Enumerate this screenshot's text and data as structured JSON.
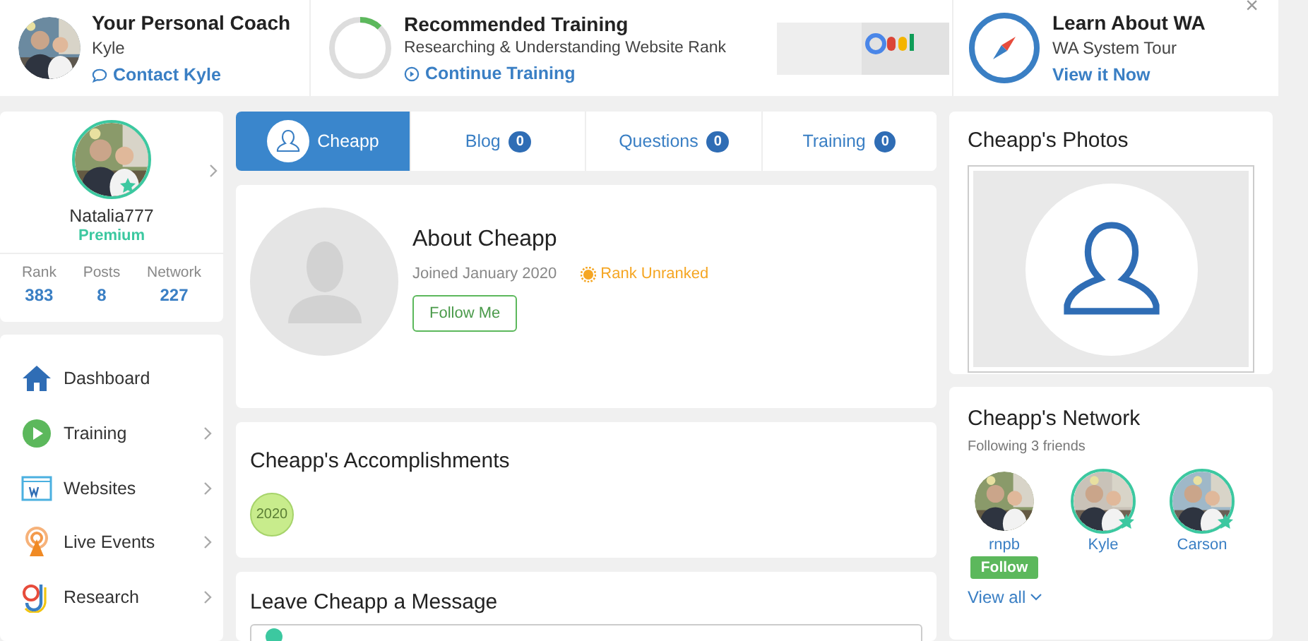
{
  "top_bar": {
    "coach": {
      "title": "Your Personal Coach",
      "name": "Kyle",
      "link": "Contact Kyle"
    },
    "training": {
      "title": "Recommended Training",
      "lesson": "Researching & Understanding Website Rank",
      "link": "Continue Training",
      "level": 0.12
    },
    "tour": {
      "title": "Learn About WA",
      "subtitle": "WA System Tour",
      "link": "View it Now"
    },
    "close": "×"
  },
  "profile": {
    "username": "Natalia777",
    "membership": "Premium",
    "premium": true,
    "stats": [
      {
        "label": "Rank",
        "value": "383"
      },
      {
        "label": "Posts",
        "value": "8"
      },
      {
        "label": "Network",
        "value": "227"
      }
    ]
  },
  "sidebar": {
    "items": [
      {
        "kind": "home",
        "label": "Dashboard",
        "expandable": false
      },
      {
        "kind": "play",
        "label": "Training",
        "expandable": true
      },
      {
        "kind": "web",
        "label": "Websites",
        "expandable": true
      },
      {
        "kind": "live",
        "label": "Live Events",
        "expandable": true
      },
      {
        "kind": "research",
        "label": "Research",
        "expandable": true
      }
    ]
  },
  "tabs": [
    {
      "label": "Cheapp",
      "selected": true
    },
    {
      "label": "Blog",
      "selected": false,
      "count": "0"
    },
    {
      "label": "Questions",
      "selected": false,
      "count": "0"
    },
    {
      "label": "Training",
      "selected": false,
      "count": "0"
    }
  ],
  "about": {
    "title": "About Cheapp",
    "joined": "Joined January 2020",
    "rank": "Rank Unranked",
    "button": "Follow Me"
  },
  "accomplishments": {
    "title": "Cheapp's Accomplishments",
    "badges": [
      "2020"
    ]
  },
  "message": {
    "title": "Leave Cheapp a Message"
  },
  "photos": {
    "title": "Cheapp's Photos"
  },
  "network": {
    "title": "Cheapp's Network",
    "subtitle": "Following 3 friends",
    "friends": [
      {
        "name": "rnpb",
        "premium": false,
        "follow": "Follow"
      },
      {
        "name": "Kyle",
        "premium": true
      },
      {
        "name": "Carson",
        "premium": true
      }
    ],
    "view_all": "View all"
  }
}
